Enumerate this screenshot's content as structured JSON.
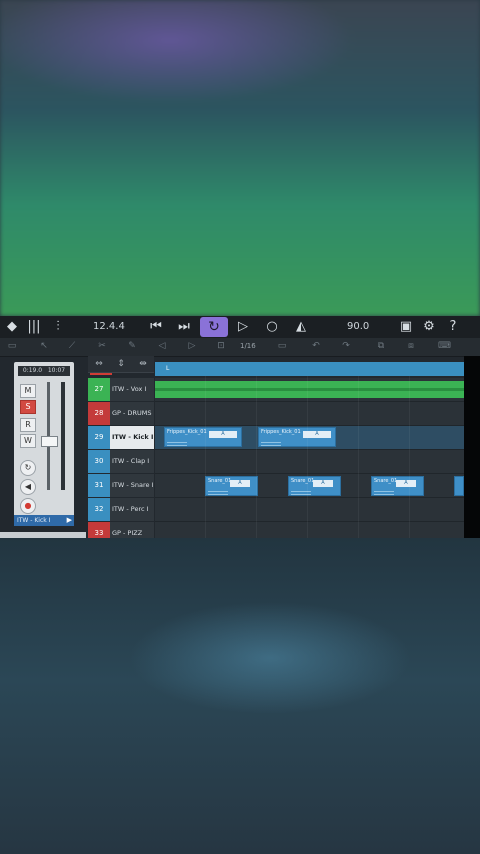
{
  "toolbar": {
    "position": "12.4.4",
    "tempo": "90.0",
    "icons": [
      "logo-icon",
      "mixer-icon",
      "eq-icon",
      "rewind-to-start-icon",
      "forward-to-end-icon",
      "loop-icon",
      "play-icon",
      "record-icon",
      "metronome-icon",
      "lock-icon",
      "gear-icon",
      "help-icon"
    ],
    "loop_color": "#8a72d8"
  },
  "subbar": {
    "quantize": "1/16",
    "labels": [
      "Undo",
      "Redo"
    ]
  },
  "channel": {
    "time_left": "0:19.0",
    "time_right": "10:07",
    "buttons": [
      "M",
      "S",
      "R",
      "W"
    ],
    "name": "ITW - Kick I"
  },
  "tracks": [
    {
      "num": "27",
      "name": "ITW - Vox I",
      "color": "#3bb354"
    },
    {
      "num": "28",
      "name": "GP - DRUMS",
      "color": "#c43a3a"
    },
    {
      "num": "29",
      "name": "ITW - Kick I",
      "color": "#3a8fc0",
      "selected": true
    },
    {
      "num": "30",
      "name": "ITW - Clap I",
      "color": "#3a8fc0"
    },
    {
      "num": "31",
      "name": "ITW - Snare I",
      "color": "#3a8fc0"
    },
    {
      "num": "32",
      "name": "ITW - Perc I",
      "color": "#3a8fc0"
    },
    {
      "num": "33",
      "name": "GP - PIZZ",
      "color": "#c43a3a"
    }
  ],
  "clips": {
    "kick_label": "Frippes_Kick_01",
    "kick_box": "A",
    "snare_label": "Snare_01",
    "snare_box": "A"
  },
  "ruler": {
    "marker": "L"
  }
}
